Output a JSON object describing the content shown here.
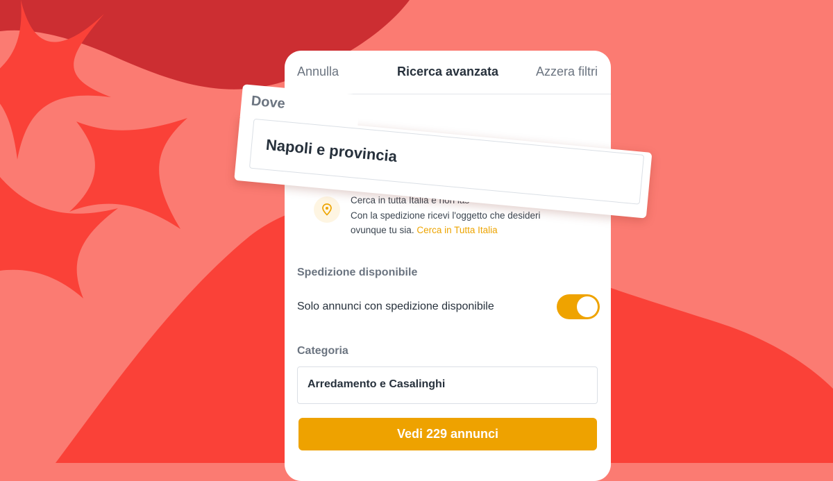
{
  "header": {
    "cancel_label": "Annulla",
    "title": "Ricerca avanzata",
    "reset_label": "Azzera filtri"
  },
  "location": {
    "label": "Dove",
    "value": "Napoli e provincia"
  },
  "info": {
    "icon": "map-pin-icon",
    "line1": "Cerca in tutta Italia e non las",
    "line2": "Con la spedizione ricevi l'oggetto che desideri",
    "line3": "ovunque tu sia.",
    "link": "Cerca in Tutta Italia"
  },
  "shipping": {
    "section_label": "Spedizione disponibile",
    "toggle_label": "Solo annunci con spedizione disponibile",
    "enabled": true
  },
  "category": {
    "section_label": "Categoria",
    "value": "Arredamento e Casalinghi"
  },
  "cta": {
    "label": "Vedi 229 annunci"
  },
  "colors": {
    "background": "#FB7B72",
    "accent": "#EEA200",
    "dark_red": "#CC2E32",
    "bright_red": "#FA4138"
  }
}
